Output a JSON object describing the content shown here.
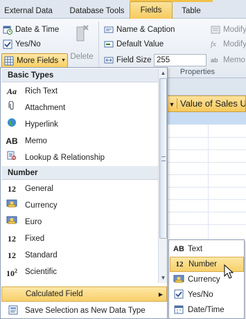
{
  "tabs": [
    {
      "label": "External Data"
    },
    {
      "label": "Database Tools"
    },
    {
      "label": "Fields"
    },
    {
      "label": "Table"
    }
  ],
  "ribbon": {
    "date_time": "Date & Time",
    "yes_no": "Yes/No",
    "more_fields": "More Fields",
    "delete": "Delete",
    "name_caption": "Name & Caption",
    "default_value": "Default Value",
    "field_size_label": "Field Size",
    "field_size_value": "255",
    "modify_1": "Modify",
    "modify_2": "Modify",
    "memo": "Memo",
    "group_properties": "Properties"
  },
  "datasheet": {
    "column_header": "Value of Sales U"
  },
  "menu": {
    "basic_header": "Basic Types",
    "basic_items": [
      {
        "label": "Rich Text",
        "icon": "rich-text-icon"
      },
      {
        "label": "Attachment",
        "icon": "paperclip-icon"
      },
      {
        "label": "Hyperlink",
        "icon": "globe-icon"
      },
      {
        "label": "Memo",
        "icon": "memo-icon"
      },
      {
        "label": "Lookup & Relationship",
        "icon": "lookup-icon"
      }
    ],
    "number_header": "Number",
    "number_items": [
      {
        "label": "General",
        "icon": "number-12-icon"
      },
      {
        "label": "Currency",
        "icon": "currency-icon"
      },
      {
        "label": "Euro",
        "icon": "euro-icon"
      },
      {
        "label": "Fixed",
        "icon": "number-12-icon"
      },
      {
        "label": "Standard",
        "icon": "number-12-icon"
      },
      {
        "label": "Scientific",
        "icon": "scientific-icon"
      }
    ],
    "calculated_field": "Calculated Field",
    "save_selection": "Save Selection as New Data Type"
  },
  "submenu": {
    "items": [
      {
        "label": "Text",
        "icon": "text-ab-icon"
      },
      {
        "label": "Number",
        "icon": "number-12-icon"
      },
      {
        "label": "Currency",
        "icon": "currency-icon"
      },
      {
        "label": "Yes/No",
        "icon": "checkbox-icon"
      },
      {
        "label": "Date/Time",
        "icon": "calendar-icon"
      }
    ]
  },
  "colors": {
    "accent_gold": "#f8cf62",
    "ribbon_bg": "#e3e9f1",
    "selection_blue": "#c8dcf3"
  }
}
